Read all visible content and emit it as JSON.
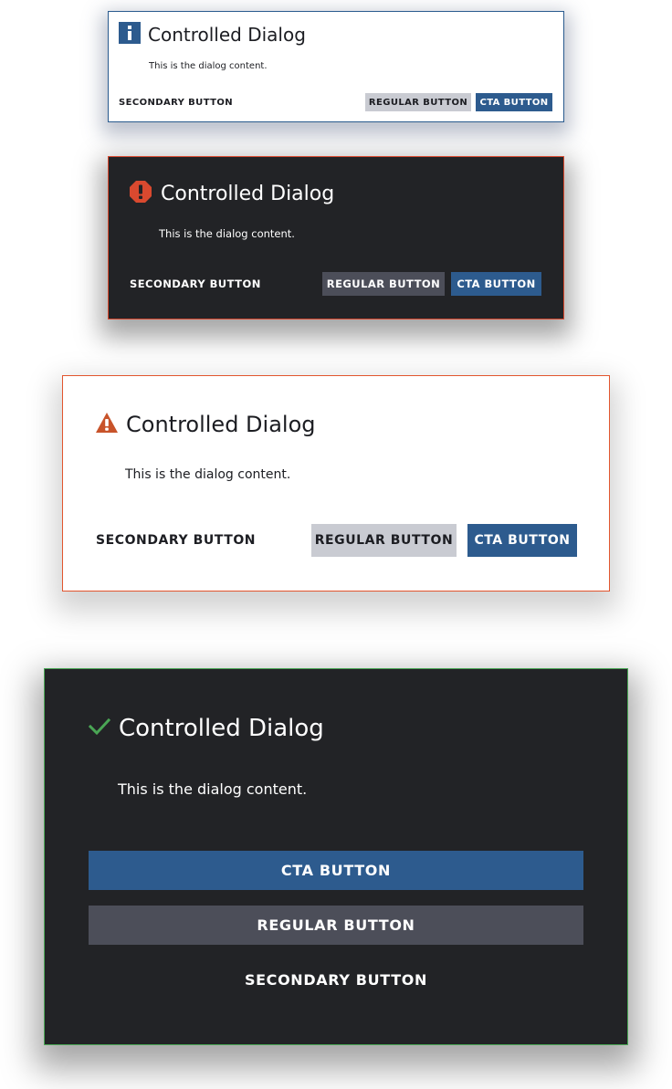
{
  "colors": {
    "cta": "#2d5b8e",
    "regular_light": "#c9cbd2",
    "regular_dark": "#4c4e59",
    "dialog_dark_bg": "#222326",
    "info": "#2d5b8e",
    "error": "#d9492f",
    "warning": "#c8532a",
    "success": "#4aa655"
  },
  "dialogs": [
    {
      "variant": "info",
      "theme": "light",
      "icon": "info-icon",
      "title": "Controlled Dialog",
      "content": "This is the dialog content.",
      "buttons": {
        "secondary": "SECONDARY BUTTON",
        "regular": "REGULAR BUTTON",
        "cta": "CTA BUTTON"
      }
    },
    {
      "variant": "error",
      "theme": "dark",
      "icon": "error-icon",
      "title": "Controlled Dialog",
      "content": "This is the dialog content.",
      "buttons": {
        "secondary": "SECONDARY BUTTON",
        "regular": "REGULAR BUTTON",
        "cta": "CTA BUTTON"
      }
    },
    {
      "variant": "warning",
      "theme": "light",
      "icon": "warning-icon",
      "title": "Controlled Dialog",
      "content": "This is the dialog content.",
      "buttons": {
        "secondary": "SECONDARY BUTTON",
        "regular": "REGULAR BUTTON",
        "cta": "CTA BUTTON"
      }
    },
    {
      "variant": "success",
      "theme": "dark",
      "icon": "check-icon",
      "title": "Controlled Dialog",
      "content": "This is the dialog content.",
      "buttons": {
        "cta": "CTA BUTTON",
        "regular": "REGULAR BUTTON",
        "secondary": "SECONDARY BUTTON"
      }
    }
  ]
}
